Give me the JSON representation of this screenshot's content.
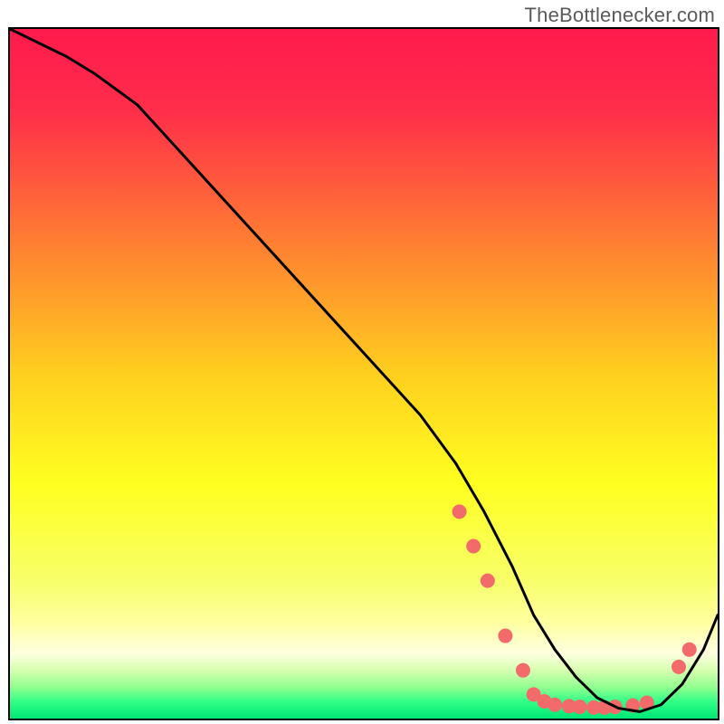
{
  "attribution": "TheBottlenecker.com",
  "chart_data": {
    "type": "line",
    "title": "",
    "xlabel": "",
    "ylabel": "",
    "xlim": [
      0,
      100
    ],
    "ylim": [
      0,
      100
    ],
    "gradient_stops": [
      {
        "offset": 0,
        "color": "#ff1a4d"
      },
      {
        "offset": 0.12,
        "color": "#ff2e4a"
      },
      {
        "offset": 0.3,
        "color": "#ff7a33"
      },
      {
        "offset": 0.5,
        "color": "#ffcf1f"
      },
      {
        "offset": 0.66,
        "color": "#ffff20"
      },
      {
        "offset": 0.8,
        "color": "#f7ff6a"
      },
      {
        "offset": 0.86,
        "color": "#ffffa0"
      },
      {
        "offset": 0.905,
        "color": "#ffffe0"
      },
      {
        "offset": 0.93,
        "color": "#d6ffb0"
      },
      {
        "offset": 0.955,
        "color": "#8fff8f"
      },
      {
        "offset": 0.975,
        "color": "#33ff88"
      },
      {
        "offset": 1.0,
        "color": "#00e676"
      }
    ],
    "series": [
      {
        "name": "bottleneck-curve",
        "x": [
          0,
          4,
          8,
          12,
          18,
          26,
          34,
          42,
          50,
          58,
          63,
          67,
          71,
          74,
          77,
          80,
          83,
          86,
          89,
          92,
          95,
          98,
          100
        ],
        "y": [
          100,
          98,
          96,
          93.5,
          89,
          80,
          71,
          62,
          53,
          44,
          37,
          30,
          22,
          15,
          10,
          6,
          3,
          1.5,
          1,
          2,
          5,
          10,
          15
        ]
      }
    ],
    "dots": {
      "name": "data-points",
      "color": "#f26a6a",
      "radius": 8,
      "points": [
        {
          "x": 63.5,
          "y": 30
        },
        {
          "x": 65.5,
          "y": 25
        },
        {
          "x": 67.5,
          "y": 20
        },
        {
          "x": 70.0,
          "y": 12
        },
        {
          "x": 72.5,
          "y": 7
        },
        {
          "x": 74.0,
          "y": 3.5
        },
        {
          "x": 75.5,
          "y": 2.5
        },
        {
          "x": 77.0,
          "y": 2.0
        },
        {
          "x": 79.0,
          "y": 1.8
        },
        {
          "x": 80.5,
          "y": 1.7
        },
        {
          "x": 82.5,
          "y": 1.6
        },
        {
          "x": 84.0,
          "y": 1.6
        },
        {
          "x": 85.5,
          "y": 1.7
        },
        {
          "x": 88.0,
          "y": 1.9
        },
        {
          "x": 90.0,
          "y": 2.3
        },
        {
          "x": 94.5,
          "y": 7.5
        },
        {
          "x": 96.0,
          "y": 10.0
        }
      ]
    }
  }
}
